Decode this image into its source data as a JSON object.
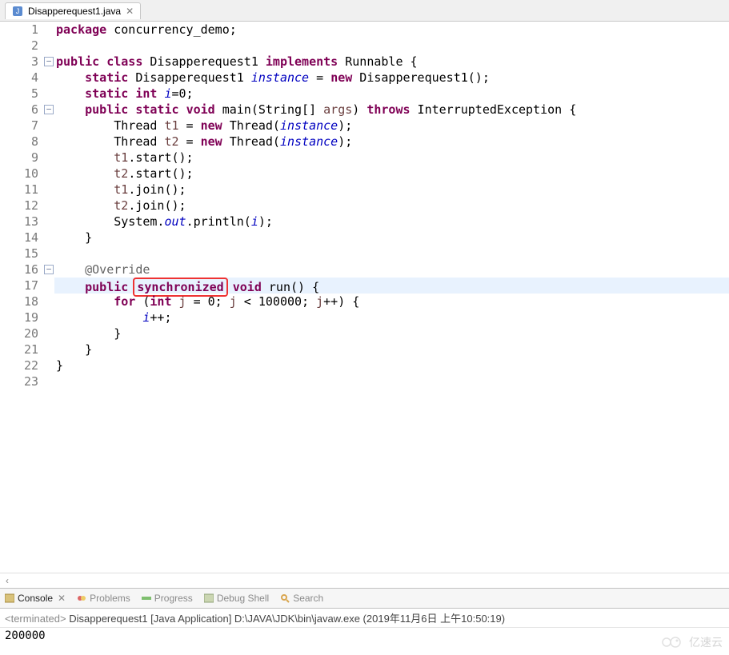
{
  "tab": {
    "filename": "Disapperequest1.java"
  },
  "code": {
    "lines": [
      {
        "n": "1",
        "frags": [
          [
            "kw",
            "package"
          ],
          [
            "",
            " concurrency_demo;"
          ]
        ]
      },
      {
        "n": "2",
        "frags": []
      },
      {
        "n": "3",
        "foldMinus": true,
        "frags": [
          [
            "kw",
            "public"
          ],
          [
            "",
            " "
          ],
          [
            "kw",
            "class"
          ],
          [
            "",
            " Disapperequest1 "
          ],
          [
            "kw",
            "implements"
          ],
          [
            "",
            " Runnable {"
          ]
        ]
      },
      {
        "n": "4",
        "frags": [
          [
            "",
            "    "
          ],
          [
            "kw",
            "static"
          ],
          [
            "",
            " Disapperequest1 "
          ],
          [
            "fldit",
            "instance"
          ],
          [
            "",
            " = "
          ],
          [
            "kw",
            "new"
          ],
          [
            "",
            " Disapperequest1();"
          ]
        ]
      },
      {
        "n": "5",
        "frags": [
          [
            "",
            "    "
          ],
          [
            "kw",
            "static"
          ],
          [
            "",
            " "
          ],
          [
            "kw",
            "int"
          ],
          [
            "",
            " "
          ],
          [
            "fldit",
            "i"
          ],
          [
            "",
            "=0;"
          ]
        ]
      },
      {
        "n": "6",
        "foldMinus": true,
        "override": true,
        "frags": [
          [
            "",
            "    "
          ],
          [
            "kw",
            "public"
          ],
          [
            "",
            " "
          ],
          [
            "kw",
            "static"
          ],
          [
            "",
            " "
          ],
          [
            "kw",
            "void"
          ],
          [
            "",
            " main(String[] "
          ],
          [
            "arg",
            "args"
          ],
          [
            "",
            ") "
          ],
          [
            "kw",
            "throws"
          ],
          [
            "",
            " InterruptedException {"
          ]
        ]
      },
      {
        "n": "7",
        "frags": [
          [
            "",
            "        Thread "
          ],
          [
            "var",
            "t1"
          ],
          [
            "",
            " = "
          ],
          [
            "kw",
            "new"
          ],
          [
            "",
            " Thread("
          ],
          [
            "fldit",
            "instance"
          ],
          [
            "",
            ");"
          ]
        ]
      },
      {
        "n": "8",
        "frags": [
          [
            "",
            "        Thread "
          ],
          [
            "var",
            "t2"
          ],
          [
            "",
            " = "
          ],
          [
            "kw",
            "new"
          ],
          [
            "",
            " Thread("
          ],
          [
            "fldit",
            "instance"
          ],
          [
            "",
            ");"
          ]
        ]
      },
      {
        "n": "9",
        "frags": [
          [
            "",
            "        "
          ],
          [
            "var",
            "t1"
          ],
          [
            "",
            ".start();"
          ]
        ]
      },
      {
        "n": "10",
        "frags": [
          [
            "",
            "        "
          ],
          [
            "var",
            "t2"
          ],
          [
            "",
            ".start();"
          ]
        ]
      },
      {
        "n": "11",
        "frags": [
          [
            "",
            "        "
          ],
          [
            "var",
            "t1"
          ],
          [
            "",
            ".join();"
          ]
        ]
      },
      {
        "n": "12",
        "frags": [
          [
            "",
            "        "
          ],
          [
            "var",
            "t2"
          ],
          [
            "",
            ".join();"
          ]
        ]
      },
      {
        "n": "13",
        "frags": [
          [
            "",
            "        System."
          ],
          [
            "fldit",
            "out"
          ],
          [
            "",
            ".println("
          ],
          [
            "fldit",
            "i"
          ],
          [
            "",
            ");"
          ]
        ]
      },
      {
        "n": "14",
        "frags": [
          [
            "",
            "    }"
          ]
        ]
      },
      {
        "n": "15",
        "frags": []
      },
      {
        "n": "16",
        "foldMinus": true,
        "override": true,
        "frags": [
          [
            "",
            "    "
          ],
          [
            "ann",
            "@Override"
          ]
        ]
      },
      {
        "n": "17",
        "hl": true,
        "frags": [
          [
            "",
            "    "
          ],
          [
            "kw",
            "public"
          ],
          [
            "",
            " "
          ],
          [
            "redbox-kw",
            "synchronized"
          ],
          [
            "",
            " "
          ],
          [
            "kw",
            "void"
          ],
          [
            "",
            " run() {"
          ]
        ]
      },
      {
        "n": "18",
        "frags": [
          [
            "",
            "        "
          ],
          [
            "kw",
            "for"
          ],
          [
            "",
            " ("
          ],
          [
            "kw",
            "int"
          ],
          [
            "",
            " "
          ],
          [
            "var",
            "j"
          ],
          [
            "",
            " = 0; "
          ],
          [
            "var",
            "j"
          ],
          [
            "",
            " < 100000; "
          ],
          [
            "var",
            "j"
          ],
          [
            "",
            "++) {"
          ]
        ]
      },
      {
        "n": "19",
        "frags": [
          [
            "",
            "            "
          ],
          [
            "fldit",
            "i"
          ],
          [
            "",
            "++;"
          ]
        ]
      },
      {
        "n": "20",
        "frags": [
          [
            "",
            "        }"
          ]
        ]
      },
      {
        "n": "21",
        "frags": [
          [
            "",
            "    }"
          ]
        ]
      },
      {
        "n": "22",
        "frags": [
          [
            "",
            "}"
          ]
        ]
      },
      {
        "n": "23",
        "frags": []
      }
    ]
  },
  "consoleTabs": {
    "console": "Console",
    "problems": "Problems",
    "progress": "Progress",
    "debugShell": "Debug Shell",
    "search": "Search"
  },
  "runInfo": {
    "status": "<terminated>",
    "launch": "Disapperequest1 [Java Application] D:\\JAVA\\JDK\\bin\\javaw.exe (2019年11月6日 上午10:50:19)"
  },
  "output": "200000",
  "watermark": "亿速云"
}
